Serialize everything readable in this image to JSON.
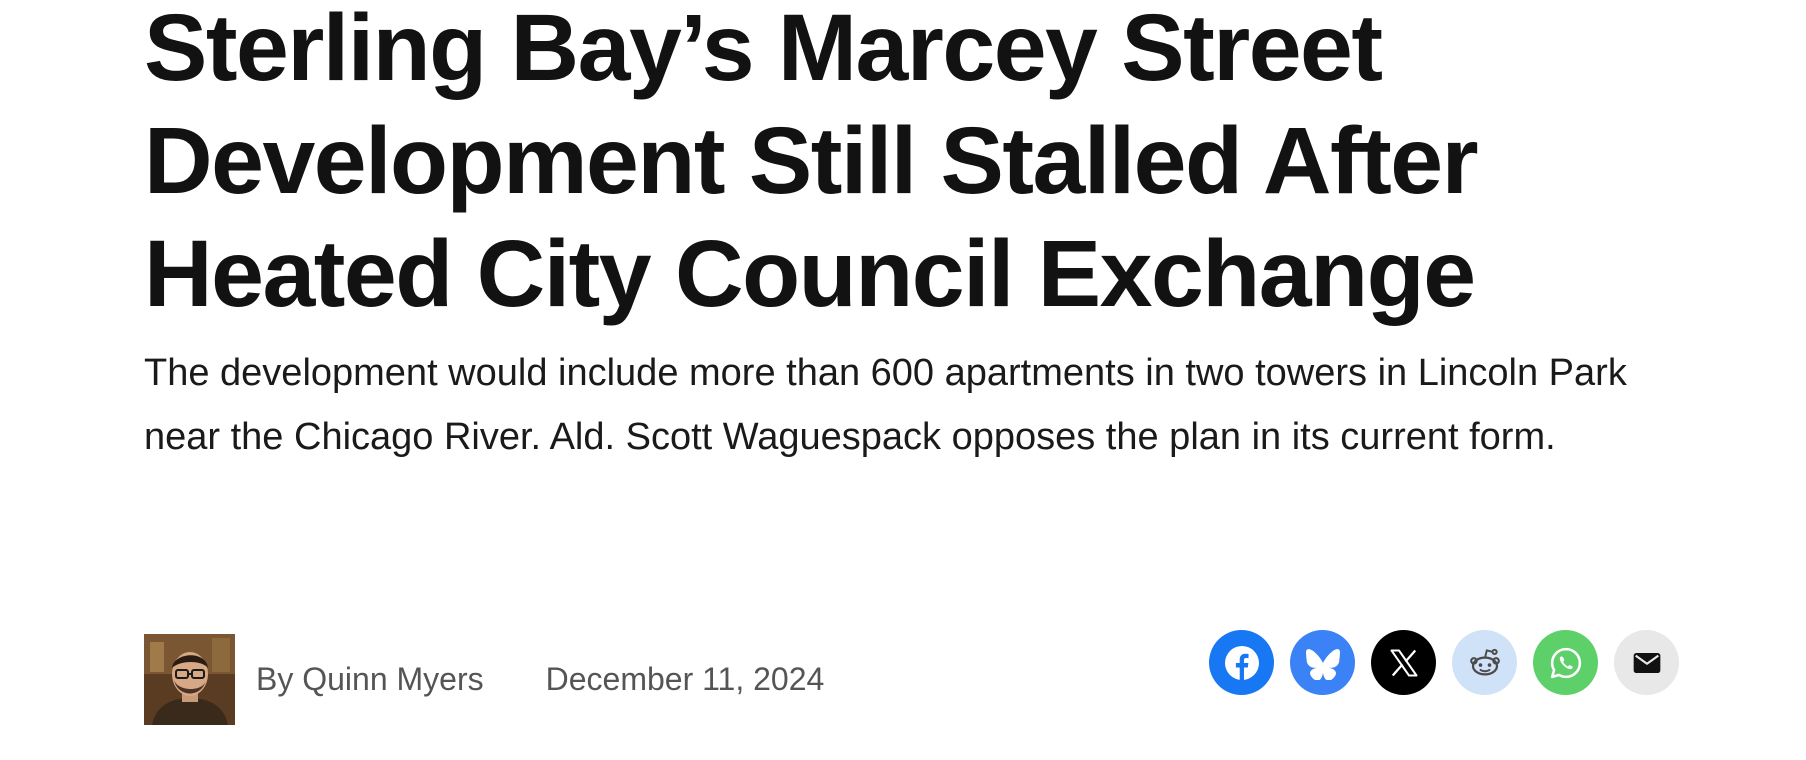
{
  "article": {
    "headline": "Sterling Bay’s Marcey Street Development Still Stalled After Heated City Council Exchange",
    "dek": "The development would include more than 600 apartments in two towers in Lincoln Park near the Chicago River. Ald. Scott Waguespack opposes the plan in its current form."
  },
  "byline": {
    "author": "By Quinn Myers",
    "date": "December 11, 2024",
    "avatar_icon": "author-photo"
  },
  "share": [
    {
      "icon": "facebook-icon",
      "color": "#1877F2"
    },
    {
      "icon": "bluesky-icon",
      "color": "#3B82F6"
    },
    {
      "icon": "x-icon",
      "color": "#000000"
    },
    {
      "icon": "reddit-icon",
      "color": "#D0E2F8"
    },
    {
      "icon": "whatsapp-icon",
      "color": "#5ED06A"
    },
    {
      "icon": "email-icon",
      "color": "#E8E8E8"
    }
  ]
}
